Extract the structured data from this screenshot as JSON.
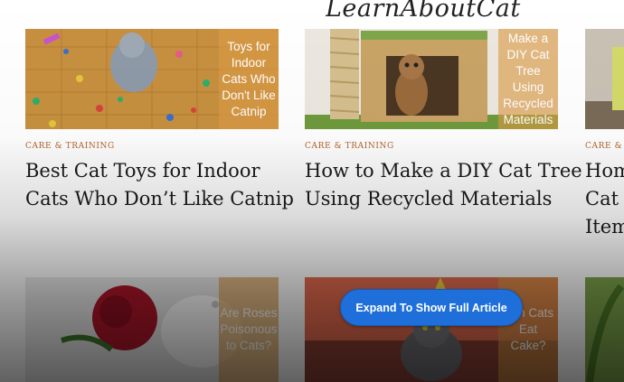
{
  "site": {
    "logo_text": "LearnAboutCat"
  },
  "articles": [
    {
      "category": "CARE & TRAINING",
      "title_line1": "Best Cat Toys for Indoor",
      "title_line2": "Cats Who Don’t Like Catnip",
      "thumb_text": "Toys for Indoor Cats Who Don't Like Catnip"
    },
    {
      "category": "CARE & TRAINING",
      "title_line1": "How to Make a DIY Cat Tree",
      "title_line2": "Using Recycled Materials",
      "thumb_text": "Make a DIY Cat Tree Using Recycled Materials"
    },
    {
      "category": "CARE & T",
      "title_line1": "Hom",
      "title_line2": "Cat I",
      "title_line3": "Item"
    },
    {
      "thumb_text": "Are Roses Poisonous to Cats?"
    },
    {
      "thumb_text": "Can Cats Eat Cake?"
    }
  ],
  "expand_button": {
    "label": "Expand To Show Full Article"
  }
}
